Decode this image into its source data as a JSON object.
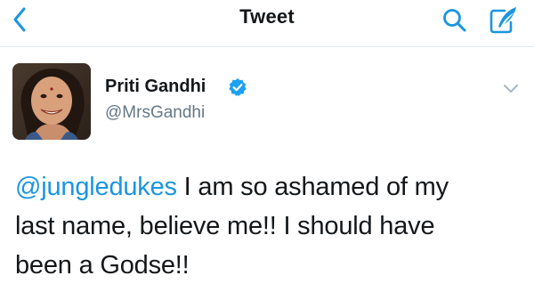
{
  "header": {
    "title": "Tweet",
    "back_icon": "chevron-left-icon",
    "search_icon": "search-icon",
    "compose_icon": "compose-quill-icon"
  },
  "tweet": {
    "author": {
      "name": "Priti Gandhi",
      "handle": "@MrsGandhi",
      "verified": true,
      "avatar_icon": "avatar-photo"
    },
    "menu_icon": "chevron-down-icon",
    "text": {
      "mention": "@jungledukes",
      "line1_rest": " I am so ashamed of my",
      "line2": "last name, believe me!! I should have",
      "line3": "been a Godse!!"
    }
  },
  "colors": {
    "accent": "#1b95e0",
    "verified_badge": "#1da1f2",
    "text_primary": "#14171a",
    "text_secondary": "#657786",
    "divider": "#e1e8ed"
  }
}
